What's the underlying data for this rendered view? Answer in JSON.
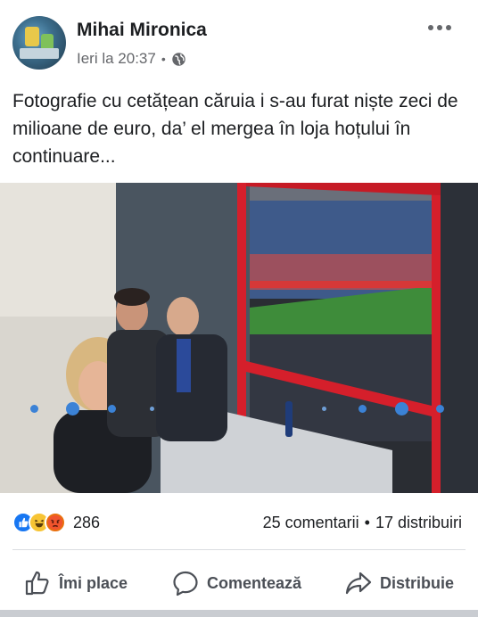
{
  "post": {
    "author": "Mihai Mironica",
    "time": "Ieri la 20:37",
    "separator": "•",
    "privacy_icon": "globe-icon",
    "menu_icon": "more-options-icon",
    "text": "Fotografie cu cetățean căruia i s-au furat niște zeci de milioane de euro, da’ el mergea în loja hoțului în continuare..."
  },
  "photo": {
    "carousel_dots": 9,
    "active_dots": [
      1,
      8
    ]
  },
  "reactions": {
    "icons": [
      "like-icon",
      "haha-icon",
      "angry-icon"
    ],
    "count": "286"
  },
  "stats": {
    "comments": "25 comentarii",
    "separator": "•",
    "shares": "17 distribuiri"
  },
  "actions": {
    "like": "Îmi place",
    "comment": "Comentează",
    "share": "Distribuie"
  },
  "colors": {
    "accent": "#1877f2",
    "text": "#1c1e21",
    "muted": "#65676b"
  }
}
